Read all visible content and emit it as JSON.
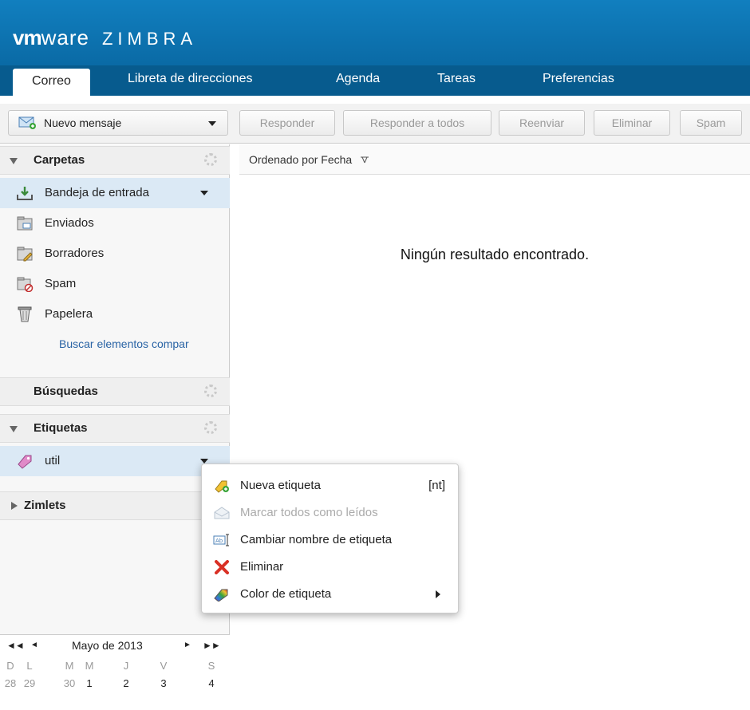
{
  "app": {
    "logo_vm": "vm",
    "logo_ware": "ware",
    "logo_product": "ZIMBRA"
  },
  "tabs": [
    {
      "label": "Correo",
      "active": true
    },
    {
      "label": "Libreta de direcciones"
    },
    {
      "label": "Agenda"
    },
    {
      "label": "Tareas"
    },
    {
      "label": "Preferencias"
    }
  ],
  "toolbar": {
    "new_message": "Nuevo mensaje",
    "reply": "Responder",
    "reply_all": "Responder a todos",
    "forward": "Reenviar",
    "delete": "Eliminar",
    "spam": "Spam"
  },
  "sidebar": {
    "folders_header": "Carpetas",
    "folders": [
      {
        "label": "Bandeja de entrada",
        "icon": "inbox-icon",
        "selected": true
      },
      {
        "label": "Enviados",
        "icon": "sent-folder-icon"
      },
      {
        "label": "Borradores",
        "icon": "drafts-folder-icon"
      },
      {
        "label": "Spam",
        "icon": "spam-folder-icon"
      },
      {
        "label": "Papelera",
        "icon": "trash-icon"
      }
    ],
    "shared_link": "Buscar elementos compar",
    "searches_header": "Búsquedas",
    "tags_header": "Etiquetas",
    "tags": [
      {
        "label": "util",
        "icon": "tag-icon"
      }
    ],
    "zimlets_header": "Zimlets"
  },
  "calendar": {
    "month": "Mayo de 2013",
    "prev_year": "◄◄",
    "prev_month": "◄",
    "next_month": "►",
    "next_year": "►►",
    "weekdays": [
      "D",
      "L",
      "M",
      "M",
      "J",
      "V",
      "S"
    ],
    "week": [
      "28",
      "29",
      "30",
      "1",
      "2",
      "3",
      "4"
    ]
  },
  "main": {
    "sort_label": "Ordenado por Fecha",
    "empty_message": "Ningún resultado encontrado."
  },
  "context_menu": {
    "items": [
      {
        "label": "Nueva etiqueta",
        "shortcut": "[nt]",
        "icon": "new-tag-icon"
      },
      {
        "label": "Marcar todos como leídos",
        "icon": "mark-read-icon",
        "disabled": true
      },
      {
        "label": "Cambiar nombre de etiqueta",
        "icon": "rename-icon"
      },
      {
        "label": "Eliminar",
        "icon": "delete-x-icon"
      },
      {
        "label": "Color de etiqueta",
        "icon": "tag-color-icon",
        "submenu": true
      }
    ]
  },
  "colors": {
    "header_blue": "#117fbf",
    "tabbar_blue": "#075b8e",
    "selection": "#dbe9f5",
    "link": "#2a64a5"
  }
}
